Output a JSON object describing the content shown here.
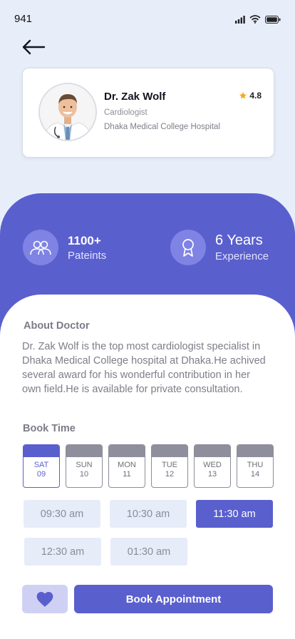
{
  "status": {
    "time": "941"
  },
  "doctor": {
    "name": "Dr. Zak Wolf",
    "rating": "4.8",
    "specialty": "Cardiologist",
    "hospital": "Dhaka Medical College Hospital"
  },
  "stats": [
    {
      "value": "1100+",
      "label": "Pateints",
      "icon": "users-icon"
    },
    {
      "value": "6 Years",
      "label": "Experience",
      "icon": "award-icon"
    }
  ],
  "about": {
    "title": "About Doctor",
    "text": "Dr. Zak Wolf is the top most cardiologist specialist in Dhaka Medical College hospital at Dhaka.He achived several award for his wonderful contribution in her own field.He is available for private consultation."
  },
  "booking": {
    "title": "Book Time",
    "days": [
      {
        "name": "SAT",
        "num": "09",
        "active": true
      },
      {
        "name": "SUN",
        "num": "10",
        "active": false
      },
      {
        "name": "MON",
        "num": "11",
        "active": false
      },
      {
        "name": "TUE",
        "num": "12",
        "active": false
      },
      {
        "name": "WED",
        "num": "13",
        "active": false
      },
      {
        "name": "THU",
        "num": "14",
        "active": false
      }
    ],
    "slots": [
      "09:30 am",
      "10:30 am",
      "11:30 am",
      "12:30 am",
      "01:30 am"
    ],
    "selected_slot": "11:30 am"
  },
  "actions": {
    "book_label": "Book Appointment"
  },
  "colors": {
    "primary": "#5a5fce",
    "background": "#e8eef9",
    "star": "#f5a623"
  }
}
